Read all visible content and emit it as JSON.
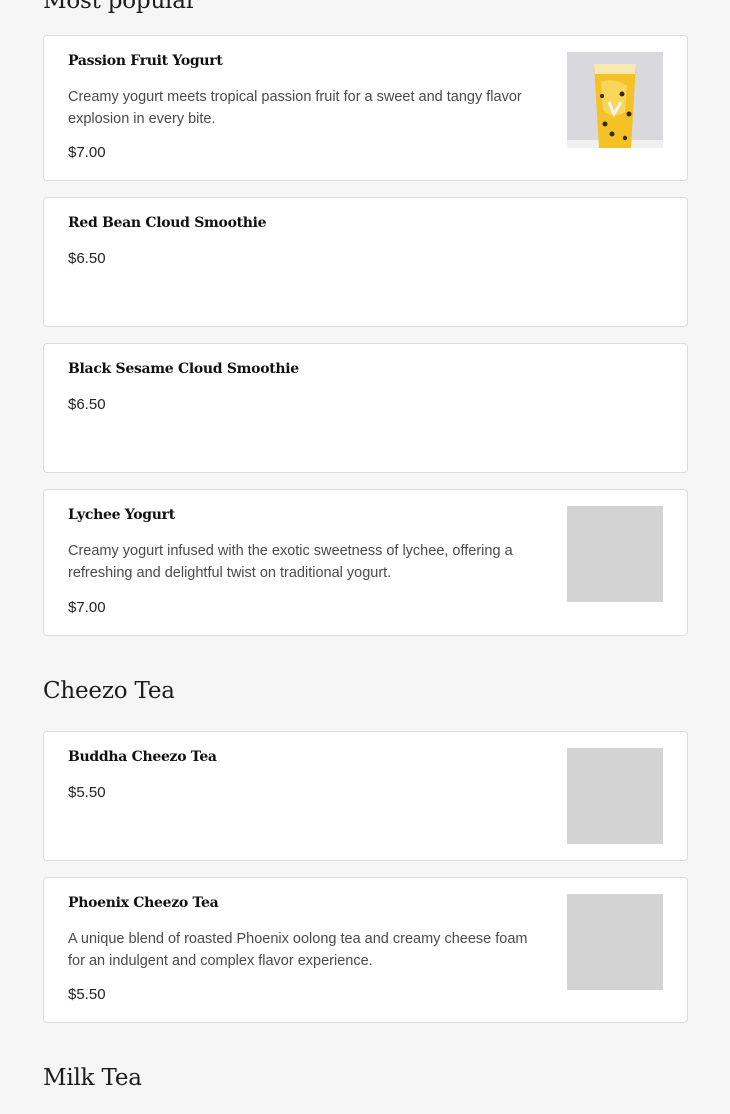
{
  "sections": {
    "most_popular": {
      "title": "Most popular"
    },
    "cheezo_tea": {
      "title": "Cheezo Tea"
    },
    "milk_tea": {
      "title": "Milk Tea"
    }
  },
  "items": [
    {
      "name": "Passion Fruit Yogurt",
      "description": "Creamy yogurt meets tropical passion fruit for a sweet and tangy flavor explosion in every bite.",
      "price": "$7.00",
      "image": "passion-fruit-yogurt-photo"
    },
    {
      "name": "Red Bean Cloud Smoothie",
      "price": "$6.50"
    },
    {
      "name": "Black Sesame Cloud Smoothie",
      "price": "$6.50"
    },
    {
      "name": "Lychee Yogurt",
      "description": "Creamy yogurt infused with the exotic sweetness of lychee, offering a refreshing and delightful twist on traditional yogurt.",
      "price": "$7.00",
      "image": "placeholder"
    },
    {
      "name": "Buddha Cheezo Tea",
      "price": "$5.50",
      "image": "placeholder"
    },
    {
      "name": "Phoenix Cheezo Tea",
      "description": "A unique blend of roasted Phoenix oolong tea and creamy cheese foam for an indulgent and complex flavor experience.",
      "price": "$5.50",
      "image": "placeholder"
    }
  ],
  "colors": {
    "page_background": "#f6f6f6",
    "card_background": "#ffffff",
    "card_border": "#dcdcdc",
    "image_placeholder": "#d3d3d3"
  }
}
